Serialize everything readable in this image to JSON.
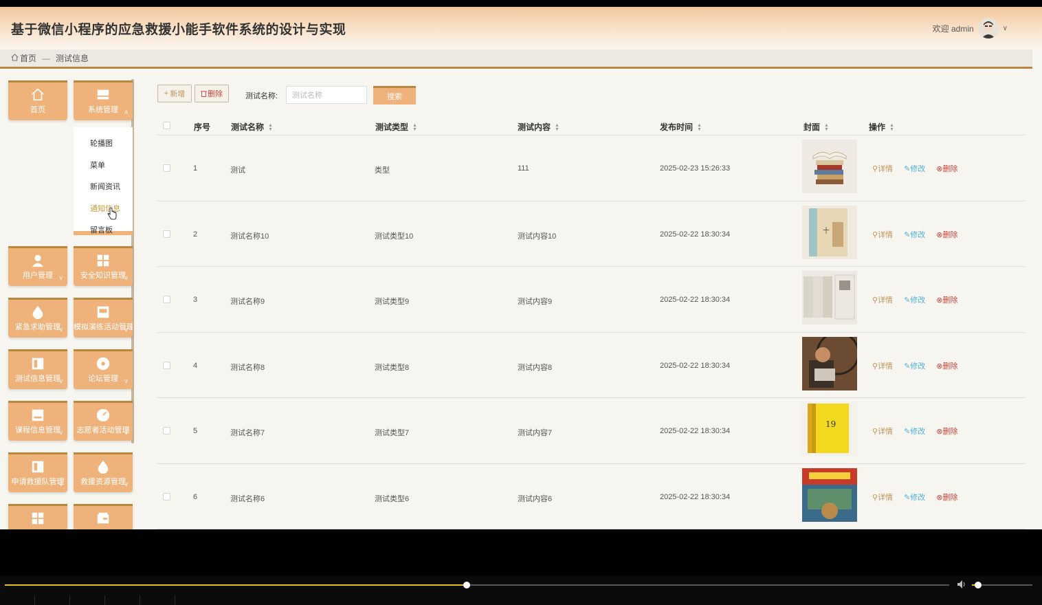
{
  "header": {
    "title": "基于微信小程序的应急救援小能手软件系统的设计与实现",
    "welcome": "欢迎 admin"
  },
  "breadcrumb": {
    "home": "首页",
    "separator": "—",
    "current": "测试信息"
  },
  "sidebar": {
    "tiles": [
      {
        "label": "首页",
        "icon": "home-icon"
      },
      {
        "label": "系统管理",
        "icon": "system-icon"
      },
      {
        "label": "用户管理",
        "icon": "user-icon"
      },
      {
        "label": "安全知识管理",
        "icon": "grid-icon"
      },
      {
        "label": "紧急求助管理",
        "icon": "drop-icon"
      },
      {
        "label": "模拟演练活动管理",
        "icon": "shop-icon"
      },
      {
        "label": "测试信息管理",
        "icon": "book-icon"
      },
      {
        "label": "论坛管理",
        "icon": "disc-icon"
      },
      {
        "label": "课程信息管理",
        "icon": "drive-icon"
      },
      {
        "label": "志愿者活动管理",
        "icon": "gauge-icon"
      },
      {
        "label": "申请救援队管理",
        "icon": "book-icon"
      },
      {
        "label": "救援资源管理",
        "icon": "drop-icon"
      },
      {
        "label": "",
        "icon": "grid-icon"
      },
      {
        "label": "",
        "icon": "wallet-icon"
      }
    ],
    "submenu": [
      "轮播图",
      "菜单",
      "新闻资讯",
      "通知信息",
      "留言板"
    ]
  },
  "toolbar": {
    "add_label": "新增",
    "delete_label": "删除",
    "search_label": "测试名称:",
    "search_placeholder": "测试名称",
    "search_button": "搜索"
  },
  "table": {
    "columns": [
      "序号",
      "测试名称",
      "测试类型",
      "测试内容",
      "发布时间",
      "封面",
      "操作"
    ],
    "rows": [
      {
        "no": "1",
        "name": "测试",
        "type": "类型",
        "content": "111",
        "time": "2025-02-23 15:26:33"
      },
      {
        "no": "2",
        "name": "测试名称10",
        "type": "测试类型10",
        "content": "测试内容10",
        "time": "2025-02-22 18:30:34"
      },
      {
        "no": "3",
        "name": "测试名称9",
        "type": "测试类型9",
        "content": "测试内容9",
        "time": "2025-02-22 18:30:34"
      },
      {
        "no": "4",
        "name": "测试名称8",
        "type": "测试类型8",
        "content": "测试内容8",
        "time": "2025-02-22 18:30:34"
      },
      {
        "no": "5",
        "name": "测试名称7",
        "type": "测试类型7",
        "content": "测试内容7",
        "time": "2025-02-22 18:30:34"
      },
      {
        "no": "6",
        "name": "测试名称6",
        "type": "测试类型6",
        "content": "测试内容6",
        "time": "2025-02-22 18:30:34"
      }
    ],
    "ops": {
      "detail": "详情",
      "edit": "修改",
      "delete": "删除"
    }
  },
  "player": {
    "progress": 0.489,
    "volume": 0.1
  },
  "colors": {
    "accent": "#efb27a",
    "accent_dark": "#b8883f",
    "link_edit": "#4fb2d8",
    "link_delete": "#c6463b"
  }
}
